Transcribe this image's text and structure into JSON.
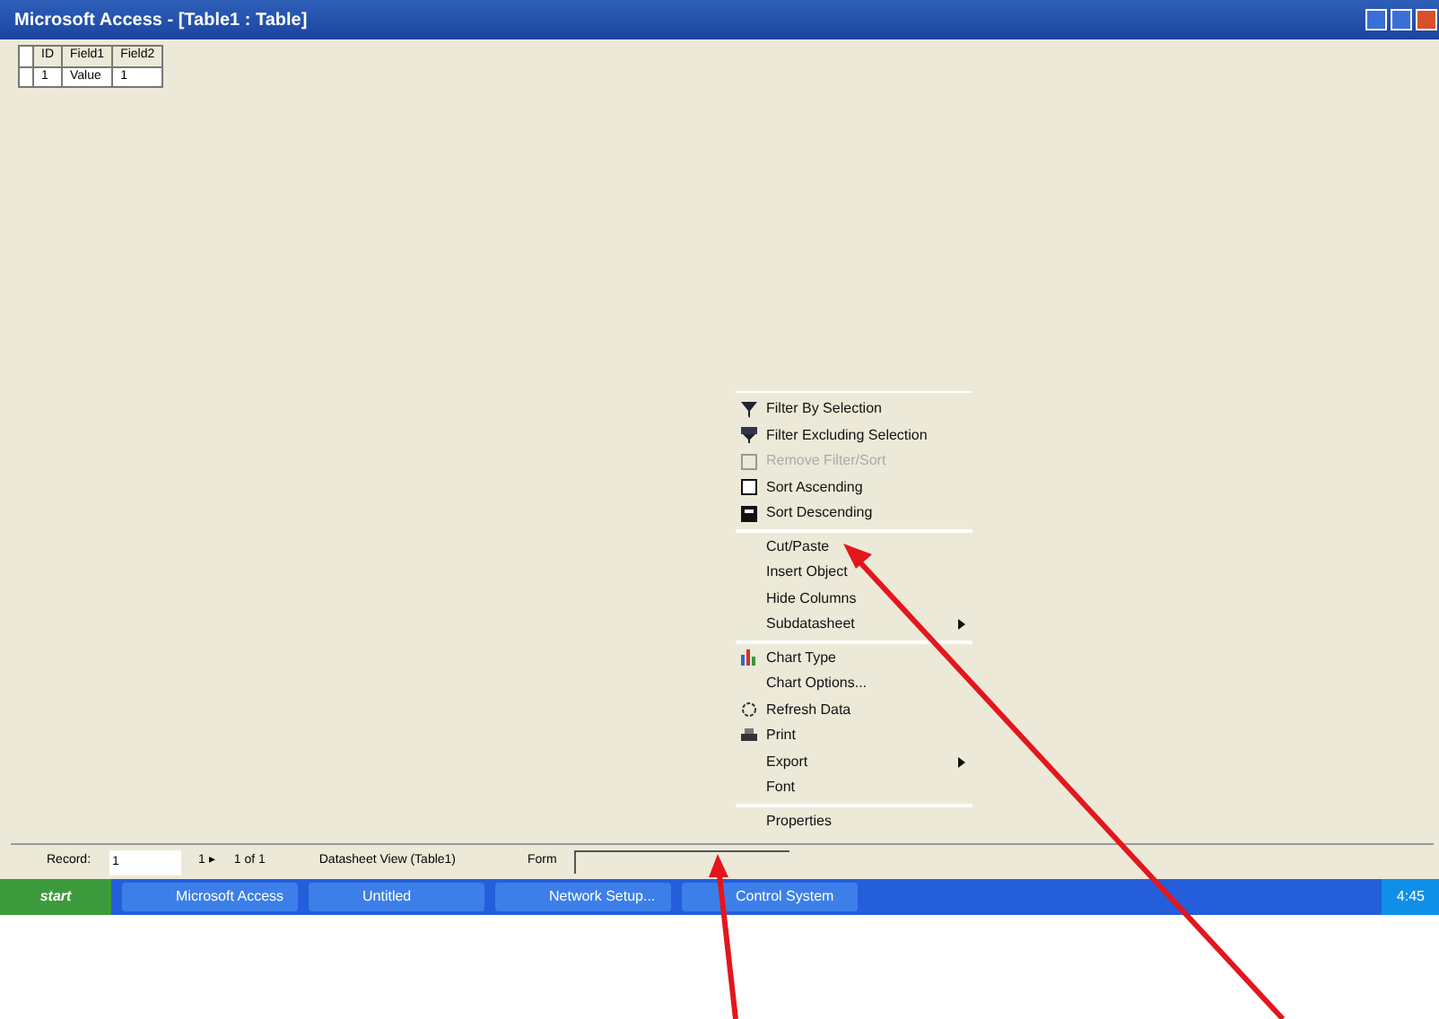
{
  "window": {
    "title": "Microsoft Access - [Table1 : Table]"
  },
  "datasheet": {
    "columns": [
      "ID",
      "Field1",
      "Field2"
    ],
    "rows": [
      [
        "1",
        "Value",
        "1"
      ]
    ]
  },
  "context_menu": {
    "groups": [
      [
        {
          "label": "Filter By Selection",
          "kind": "icon",
          "disabled": false,
          "submenu": false
        },
        {
          "label": "Filter Excluding Selection",
          "kind": "icon",
          "disabled": false,
          "submenu": false
        },
        {
          "label": "Remove Filter/Sort",
          "kind": "icon",
          "disabled": true,
          "submenu": false
        },
        {
          "label": "Sort Ascending",
          "kind": "icon",
          "disabled": false,
          "submenu": false
        },
        {
          "label": "Sort Descending",
          "kind": "icon",
          "disabled": false,
          "submenu": false
        }
      ],
      [
        {
          "label": "Cut/Paste",
          "kind": "plain",
          "disabled": false,
          "submenu": false
        },
        {
          "label": "Insert Object",
          "kind": "plain",
          "disabled": false,
          "submenu": false
        },
        {
          "label": "Hide Columns",
          "kind": "plain",
          "disabled": false,
          "submenu": false
        },
        {
          "label": "Subdatasheet",
          "kind": "plain",
          "disabled": false,
          "submenu": true
        }
      ],
      [
        {
          "label": "Chart Type",
          "kind": "icon",
          "disabled": false,
          "submenu": false
        },
        {
          "label": "Chart Options...",
          "kind": "plain",
          "disabled": false,
          "submenu": false
        },
        {
          "label": "Refresh Data",
          "kind": "icon",
          "disabled": false,
          "submenu": false
        },
        {
          "label": "Print",
          "kind": "icon",
          "disabled": false,
          "submenu": false
        },
        {
          "label": "Export",
          "kind": "plain",
          "disabled": false,
          "submenu": true
        },
        {
          "label": "Font",
          "kind": "plain",
          "disabled": false,
          "submenu": false
        }
      ],
      [
        {
          "label": "Properties",
          "kind": "plain",
          "disabled": false,
          "submenu": false
        }
      ]
    ]
  },
  "status_bar": {
    "record_label": "Record:",
    "record_value": "1",
    "record_nav": "1 ▸",
    "record_count": "1 of 1",
    "view": "Datasheet View (Table1)",
    "field_label": "Form"
  },
  "taskbar": {
    "start": "start",
    "buttons": [
      "Microsoft Access",
      "Untitled",
      "Network Setup...",
      "Control System"
    ],
    "tray": "4:45"
  }
}
